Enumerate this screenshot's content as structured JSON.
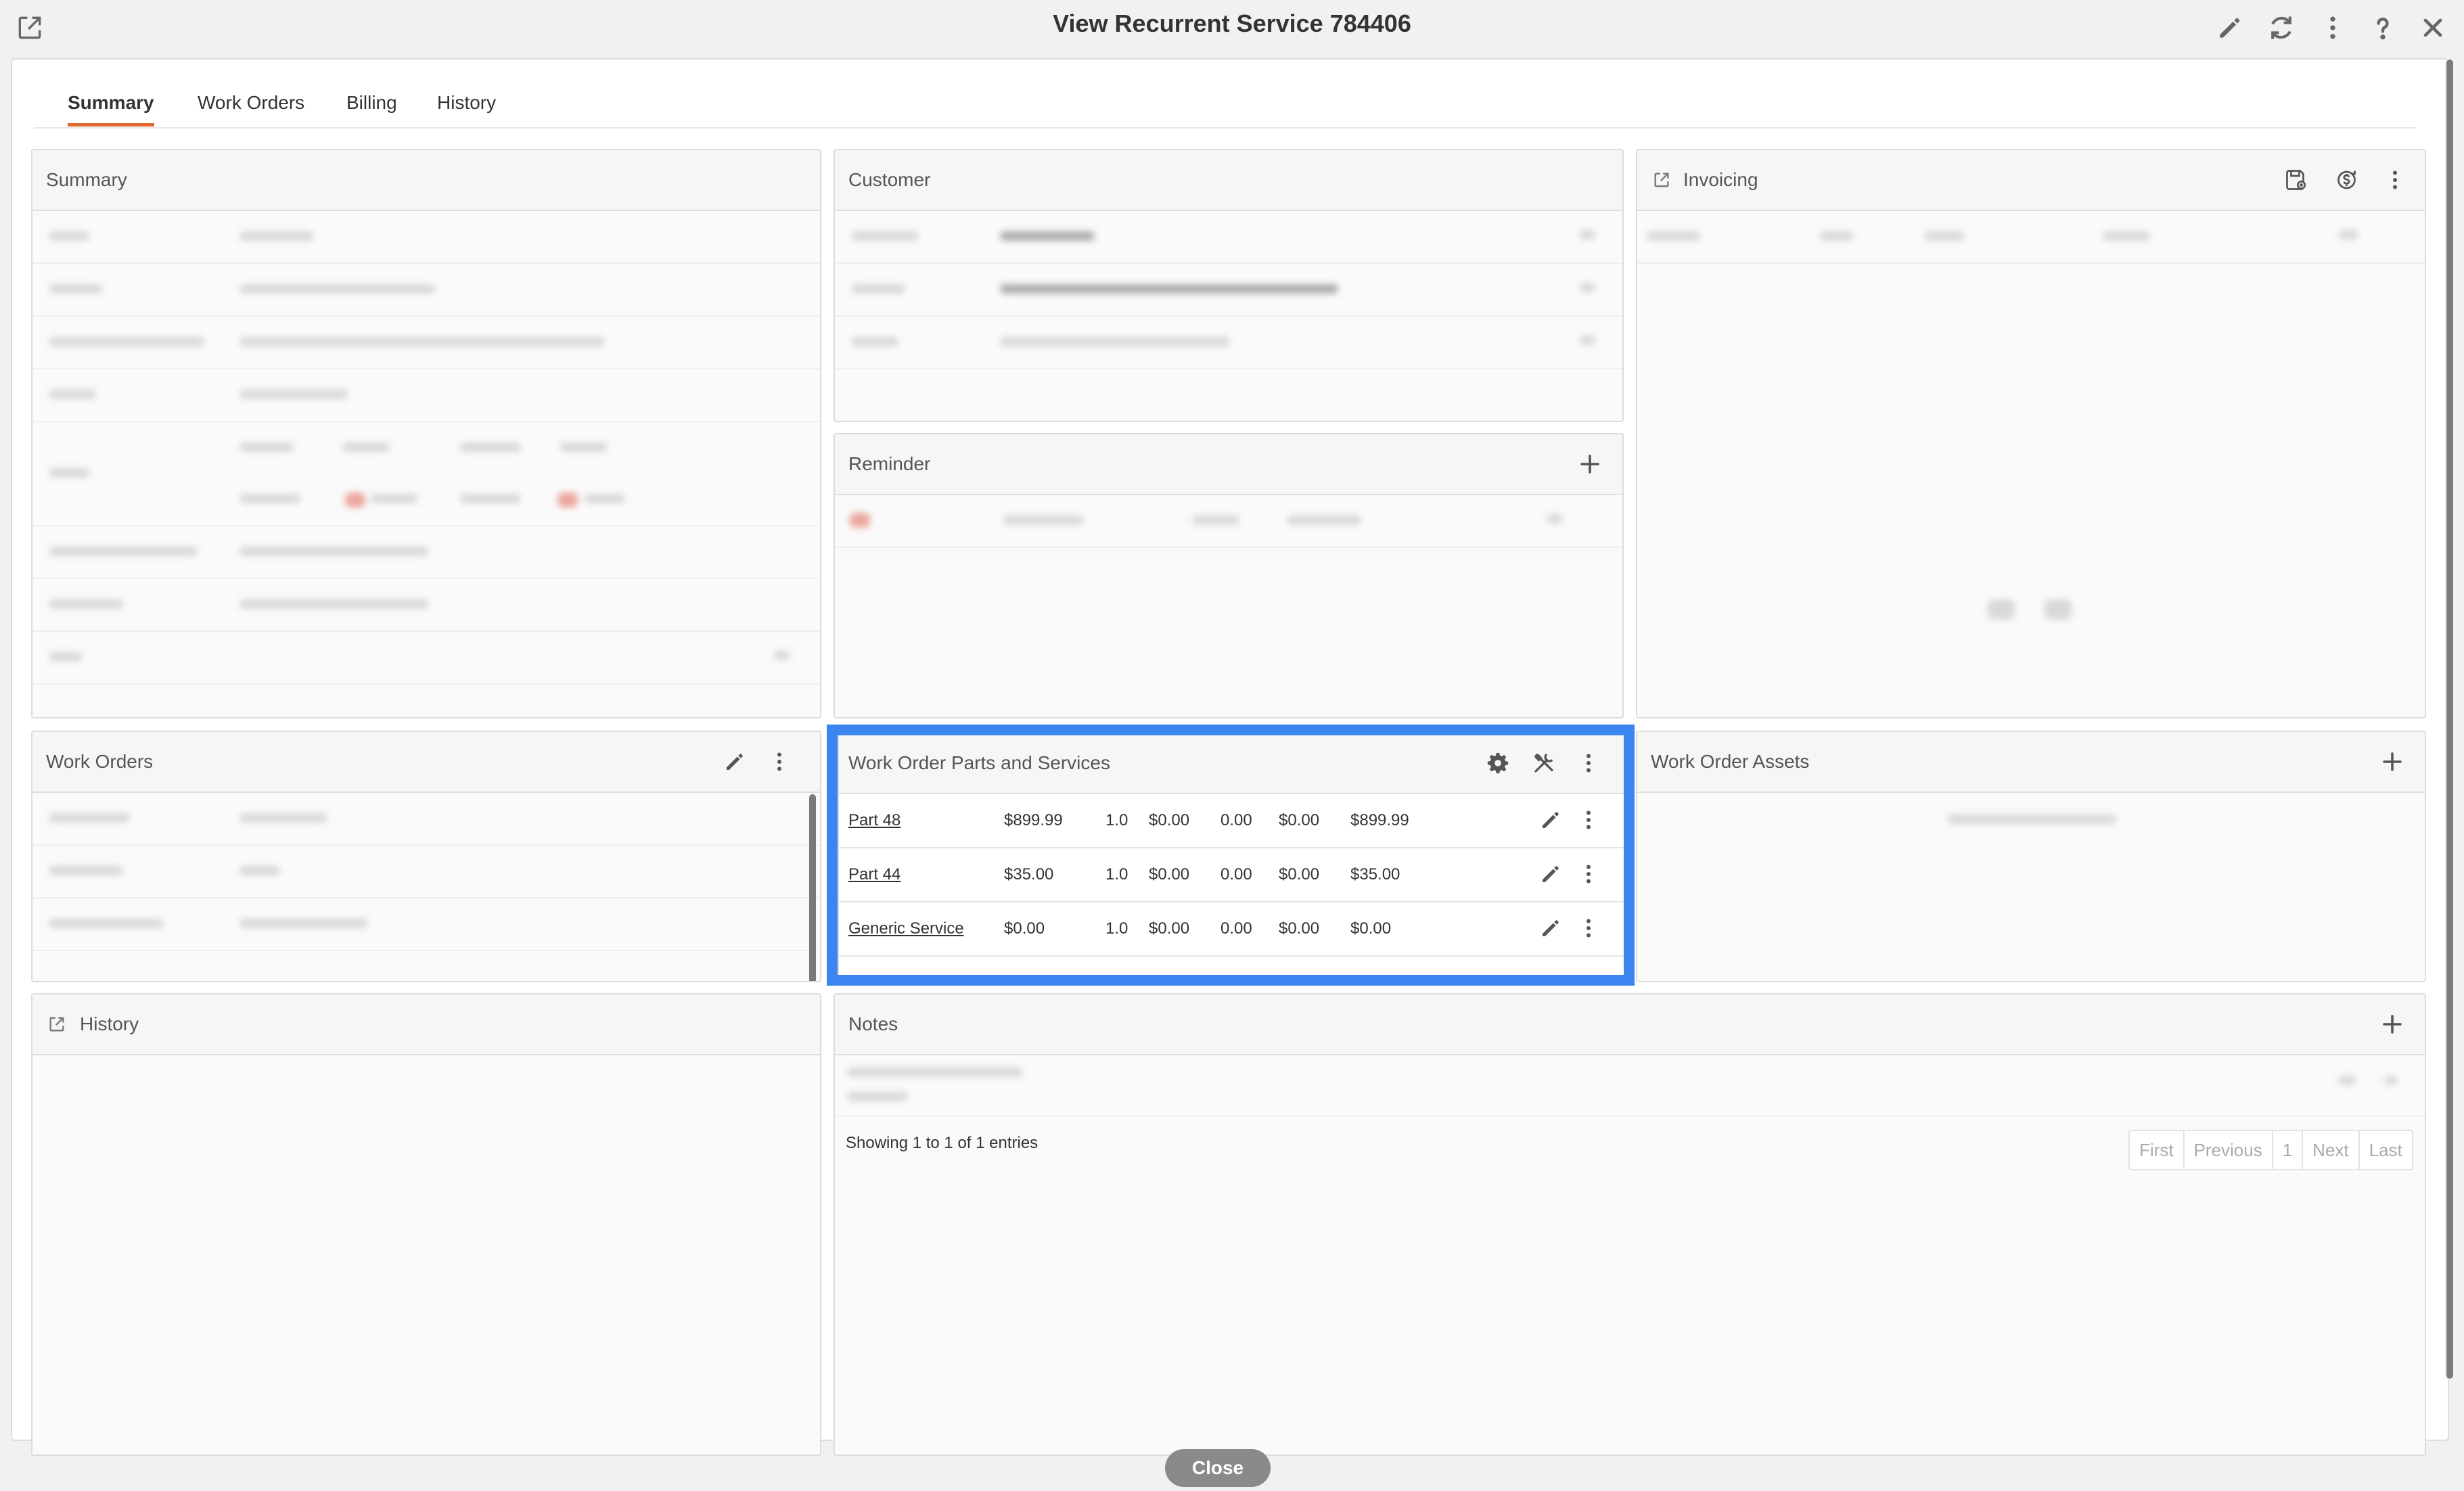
{
  "window": {
    "title": "View Recurrent Service 784406",
    "toolbar_icons": [
      "external-link-icon",
      "pencil-icon",
      "refresh-icon",
      "more-vertical-icon",
      "help-icon",
      "close-icon"
    ]
  },
  "tabs": [
    {
      "label": "Summary",
      "active": true
    },
    {
      "label": "Work Orders",
      "active": false
    },
    {
      "label": "Billing",
      "active": false
    },
    {
      "label": "History",
      "active": false
    }
  ],
  "panels": {
    "summary": {
      "title": "Summary"
    },
    "customer": {
      "title": "Customer"
    },
    "invoicing": {
      "title": "Invoicing"
    },
    "reminder": {
      "title": "Reminder"
    },
    "work_orders": {
      "title": "Work Orders"
    },
    "parts_services": {
      "title": "Work Order Parts and Services",
      "rows": [
        {
          "name": "Part 48",
          "price": "$899.99",
          "qty": "1.0",
          "discount": "$0.00",
          "tax_rate": "0.00",
          "tax": "$0.00",
          "total": "$899.99"
        },
        {
          "name": "Part 44",
          "price": "$35.00",
          "qty": "1.0",
          "discount": "$0.00",
          "tax_rate": "0.00",
          "tax": "$0.00",
          "total": "$35.00"
        },
        {
          "name": "Generic Service",
          "price": "$0.00",
          "qty": "1.0",
          "discount": "$0.00",
          "tax_rate": "0.00",
          "tax": "$0.00",
          "total": "$0.00"
        }
      ]
    },
    "assets": {
      "title": "Work Order Assets"
    },
    "history": {
      "title": "History"
    },
    "notes": {
      "title": "Notes",
      "info": "Showing 1 to 1 of 1 entries",
      "pager": {
        "first": "First",
        "previous": "Previous",
        "page": "1",
        "next": "Next",
        "last": "Last"
      }
    }
  },
  "footer": {
    "close_label": "Close"
  },
  "colors": {
    "accent_tab": "#e06a2d",
    "highlight": "#3a85f0",
    "close_button": "#8a8a8a"
  }
}
